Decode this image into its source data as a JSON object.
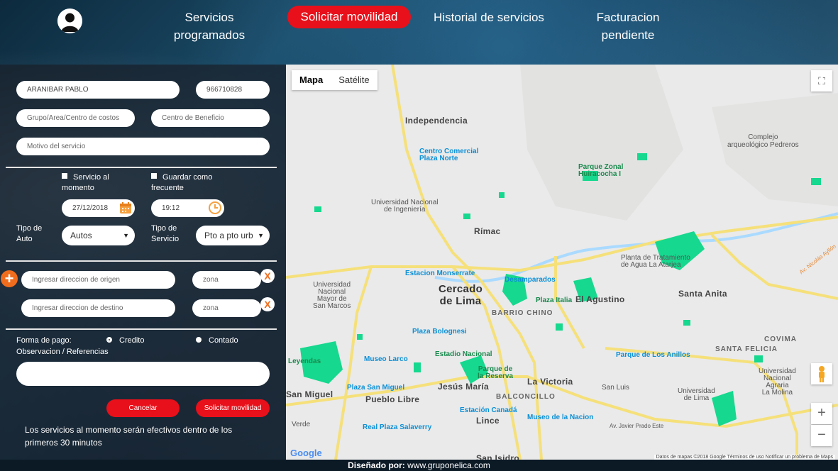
{
  "nav": {
    "items": [
      "Servicios\nprogramados",
      "Solicitar movilidad",
      "Historial de servicios",
      "Facturacion\npendiente"
    ],
    "prog_line1": "Servicios",
    "prog_line2": "programados",
    "active": "Solicitar movilidad",
    "historial": "Historial de servicios",
    "fact_line1": "Facturacion",
    "fact_line2": "pendiente"
  },
  "form": {
    "name": "ARANIBAR PABLO",
    "phone": "966710828",
    "grupo_placeholder": "Grupo/Area/Centro de costos",
    "beneficio_placeholder": "Centro de Beneficio",
    "motivo_placeholder": "Motivo del servicio",
    "servicio_momento_1": "Servicio al",
    "servicio_momento_2": "momento",
    "guardar_1": "Guardar como",
    "guardar_2": "frecuente",
    "date": "27/12/2018",
    "time": "19:12",
    "tipo_auto_1": "Tipo de",
    "tipo_auto_2": "Auto",
    "tipo_auto_value": "Autos",
    "tipo_servicio_1": "Tipo de",
    "tipo_servicio_2": "Servicio",
    "tipo_servicio_value": "Pto a pto urb",
    "origen_placeholder": "Ingresar direccion de origen",
    "destino_placeholder": "Ingresar direccion de destino",
    "zona_placeholder": "zona",
    "forma_pago": "Forma de pago:",
    "credito": "Credito",
    "contado": "Contado",
    "observacion": "Observacion / Referencias",
    "cancel": "Cancelar",
    "submit": "Solicitar movilidad",
    "note": "Los servicios al momento serán efectivos dentro de los primeros 30 minutos",
    "x": "X",
    "plus": "+"
  },
  "map": {
    "tab_map": "Mapa",
    "tab_sat": "Satélite",
    "zoom_in": "+",
    "zoom_out": "−",
    "attribution": "Datos de mapas ©2018 Google    Términos de uso    Notificar un problema de Maps",
    "google": "Google",
    "places": {
      "independencia": "Independencia",
      "cc_norte_1": "Centro Comercial",
      "cc_norte_2": "Plaza Norte",
      "parque_zonal_1": "Parque Zonal",
      "parque_zonal_2": "Huiracocha I",
      "complejo_1": "Complejo",
      "complejo_2": "arqueológico Pedreros",
      "uni_1": "Universidad Nacional",
      "uni_2": "de Ingeniería",
      "rimac": "Rímac",
      "planta_1": "Planta de Tratamiento",
      "planta_2": "de Agua La Atarjea",
      "monserrate": "Estacion Monserrate",
      "desamparados": "Desamparados",
      "cercado_1": "Cercado",
      "cercado_2": "de Lima",
      "santa_anita": "Santa Anita",
      "unmsm_1": "Universidad",
      "unmsm_2": "Nacional",
      "unmsm_3": "Mayor de",
      "unmsm_4": "San Marcos",
      "plaza_italia": "Plaza Italia",
      "el_agustino": "El Agustino",
      "barrio_chino": "BARRIO CHINO",
      "plaza_bolognesi": "Plaza Bolognesi",
      "leyendas": "Leyendas",
      "museo_larco_1": "Museo Larco",
      "estadio": "Estadio Nacional",
      "parque_reserva_1": "Parque de",
      "parque_reserva_2": "la Reserva",
      "parque_anillos": "Parque de Los Anillos",
      "santa_felicia": "SANTA FELICIA",
      "covima": "COVIMA",
      "la_victoria": "La Victoria",
      "plaza_sm": "Plaza San Miguel",
      "jesus_maria": "Jesús María",
      "san_luis": "San Luis",
      "san_miguel": "San Miguel",
      "pueblo_libre": "Pueblo Libre",
      "balconcillo": "BALCONCILLO",
      "univ_lima_1": "Universidad",
      "univ_lima_2": "de Lima",
      "unalm_1": "Universidad",
      "unalm_2": "Nacional",
      "unalm_3": "Agraria",
      "unalm_4": "La Molina",
      "canada": "Estación Canadá",
      "lince": "Lince",
      "museo_nacion": "Museo de la Nacion",
      "real_plaza": "Real Plaza Salaverry",
      "san_isidro": "San Isidro",
      "verde": "Verde",
      "av_javier": "Av. Javier Prado Este",
      "av_nicolas": "Av. Nicolás Ayllón"
    }
  },
  "footer": {
    "label": "Diseñado por:",
    "url": "www.gruponelica.com"
  },
  "colors": {
    "accent": "#e8101a",
    "orange": "#f06d1e",
    "park": "#16d88e",
    "road": "#f5e07a"
  }
}
